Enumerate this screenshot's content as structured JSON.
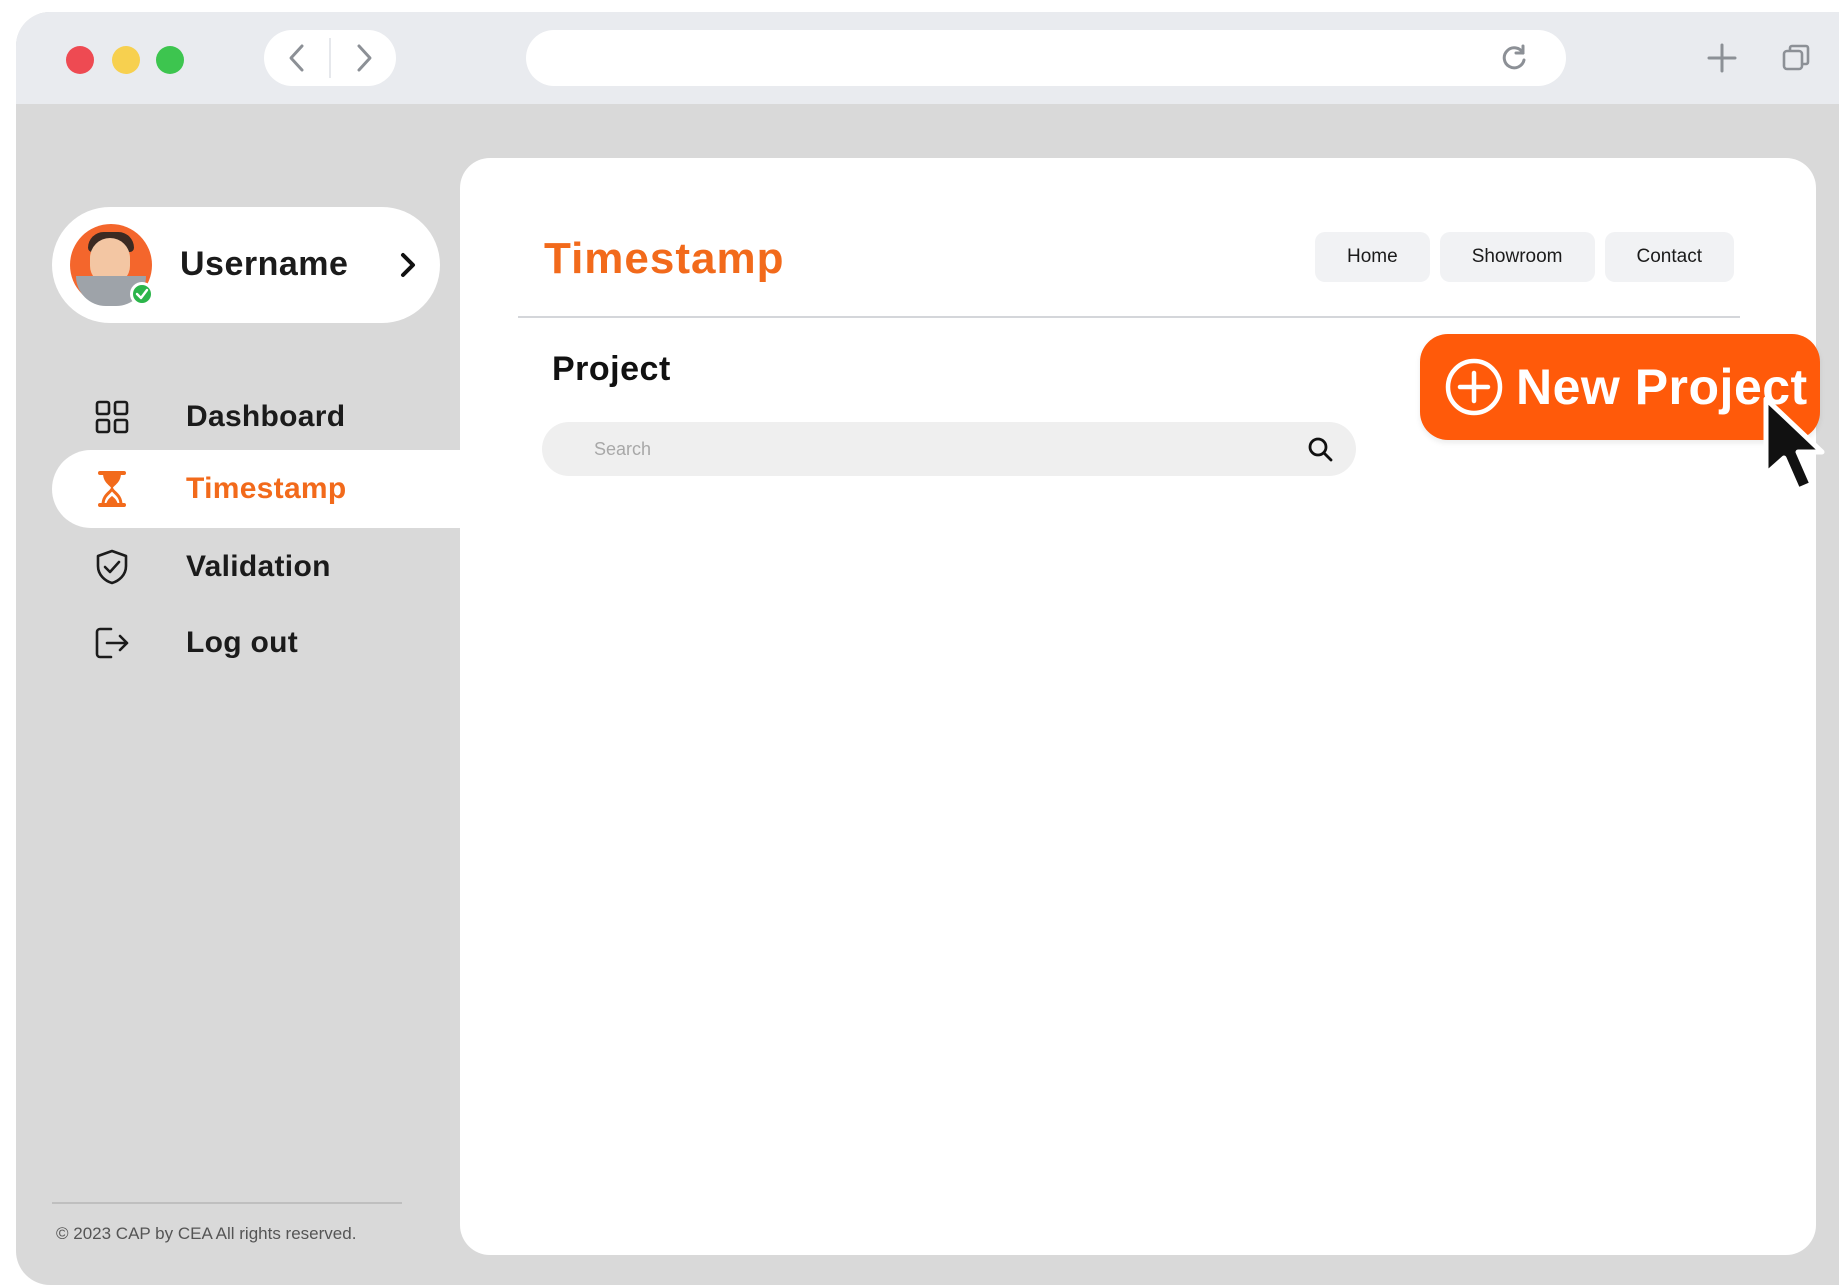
{
  "browser": {
    "url": "",
    "controls": {
      "back_icon": "chevron-left-icon",
      "forward_icon": "chevron-right-icon",
      "reload_icon": "reload-icon",
      "new_tab_icon": "plus-icon",
      "tabs_icon": "tabs-icon"
    }
  },
  "colors": {
    "accent": "#F26A1B",
    "button": "#FF5A0A",
    "sidebar_bg": "#D9D9D9",
    "online": "#2BB54A"
  },
  "user": {
    "name": "Username",
    "status": "online"
  },
  "sidebar": {
    "items": [
      {
        "label": "Dashboard",
        "icon": "grid-icon",
        "active": false
      },
      {
        "label": "Timestamp",
        "icon": "hourglass-icon",
        "active": true
      },
      {
        "label": "Validation",
        "icon": "shield-check-icon",
        "active": false
      },
      {
        "label": "Log out",
        "icon": "logout-icon",
        "active": false
      }
    ],
    "footer": "© 2023  CAP by CEA All rights reserved."
  },
  "main": {
    "title": "Timestamp",
    "nav": [
      "Home",
      "Showroom",
      "Contact"
    ],
    "section_title": "Project",
    "search": {
      "placeholder": "Search",
      "value": ""
    },
    "new_project_label": "New Project"
  }
}
